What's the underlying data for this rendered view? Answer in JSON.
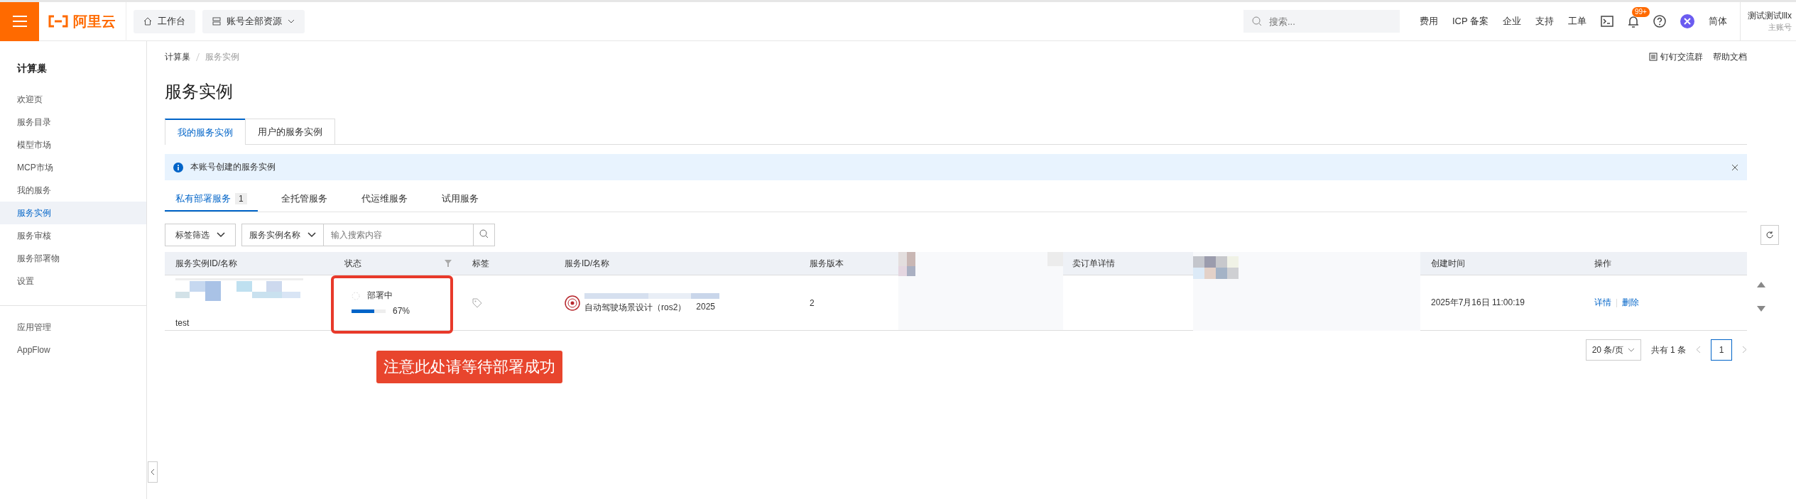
{
  "topbar": {
    "logo": "阿里云",
    "workbench": "工作台",
    "resource_menu": "账号全部资源",
    "search": {
      "placeholder": "搜索..."
    },
    "links": [
      "费用",
      "ICP 备案",
      "企业",
      "支持",
      "工单"
    ],
    "notification_badge": "99+",
    "language": "简体",
    "user": {
      "name": "测试测试lllx",
      "role": "主账号"
    }
  },
  "sidebar": {
    "title": "计算巢",
    "items": [
      {
        "label": "欢迎页",
        "selected": false
      },
      {
        "label": "服务目录",
        "selected": false
      },
      {
        "label": "模型市场",
        "selected": false
      },
      {
        "label": "MCP市场",
        "selected": false
      },
      {
        "label": "我的服务",
        "selected": false
      },
      {
        "label": "服务实例",
        "selected": true
      },
      {
        "label": "服务审核",
        "selected": false
      },
      {
        "label": "服务部署物",
        "selected": false
      },
      {
        "label": "设置",
        "selected": false
      }
    ],
    "bottom_items": [
      {
        "label": "应用管理",
        "selected": false
      },
      {
        "label": "AppFlow",
        "selected": false
      }
    ]
  },
  "breadcrumb": [
    "计算巢",
    "服务实例"
  ],
  "header_links": [
    "钉钉交流群",
    "帮助文档"
  ],
  "page_title": "服务实例",
  "tabs": [
    {
      "label": "我的服务实例",
      "selected": true
    },
    {
      "label": "用户的服务实例",
      "selected": false
    }
  ],
  "alert": {
    "text": "本账号创建的服务实例"
  },
  "sub_tabs": [
    {
      "label": "私有部署服务",
      "count": "1",
      "selected": true
    },
    {
      "label": "全托管服务",
      "selected": false
    },
    {
      "label": "代运维服务",
      "selected": false
    },
    {
      "label": "试用服务",
      "selected": false
    }
  ],
  "filters": {
    "tag_filter": "标签筛选",
    "field_select": "服务实例名称",
    "search": {
      "placeholder": "输入搜索内容"
    }
  },
  "table": {
    "columns": [
      "服务实例ID/名称",
      "状态",
      "标签",
      "服务ID/名称",
      "服务版本",
      "卖订单详情",
      "创建时间",
      "操作"
    ],
    "rows": [
      {
        "name": "test",
        "status": "部署中",
        "level": 0.67,
        "progress": "67%",
        "service": "自动驾驶场景设计（ros2）",
        "service_year": "2025",
        "version": "2",
        "created": "2025年7月16日 11:00:19",
        "actions": [
          "详情",
          "删除"
        ]
      }
    ]
  },
  "pagination": {
    "page_size": "20 条/页",
    "total": "共有 1 条",
    "pages": [
      {
        "label": "1",
        "selected": true
      }
    ]
  },
  "annotation": {
    "text": "注意此处请等待部署成功"
  }
}
